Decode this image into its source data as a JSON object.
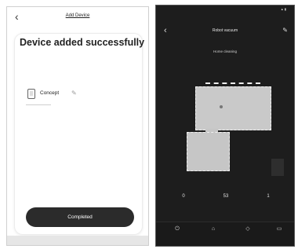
{
  "left_screen": {
    "header": {
      "title": "Add Device",
      "back_icon": "chevron-left-icon"
    },
    "card": {
      "success_message": "Device added successfully",
      "device": {
        "name": "Concept",
        "icon": "device-icon",
        "edit_icon": "pencil-icon"
      }
    },
    "completed_button_label": "Completed"
  },
  "right_screen": {
    "header": {
      "title": "Robot vacuum",
      "back_icon": "chevron-left-icon",
      "edit_icon": "pencil-icon"
    },
    "status_text": "Home cleaning",
    "stats": [
      {
        "value": "0",
        "label": ""
      },
      {
        "value": "53",
        "label": ""
      },
      {
        "value": "1",
        "label": ""
      }
    ],
    "nav": [
      {
        "icon": "power-icon",
        "label": ""
      },
      {
        "icon": "home-icon",
        "label": ""
      },
      {
        "icon": "area-icon",
        "label": ""
      },
      {
        "icon": "map-icon",
        "label": ""
      }
    ]
  },
  "colors": {
    "left_bg": "#ffffff",
    "button_bg": "#2b2b2b",
    "right_bg": "#1d1d1d",
    "map_room": "#c9c9c9"
  }
}
